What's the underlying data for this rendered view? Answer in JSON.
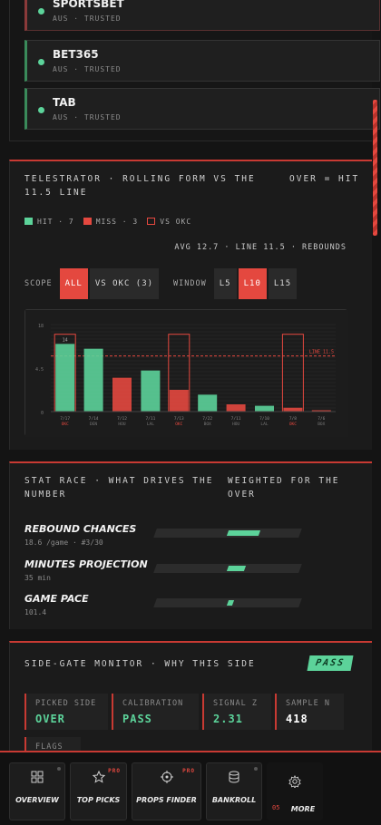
{
  "books": [
    {
      "name": "SPORTSBET",
      "sub": "AUS · TRUSTED"
    },
    {
      "name": "BET365",
      "sub": "AUS · TRUSTED"
    },
    {
      "name": "TAB",
      "sub": "AUS · TRUSTED"
    }
  ],
  "telestrator": {
    "title_left": "TELESTRATOR · ROLLING FORM VS THE 11.5 LINE",
    "title_right": "OVER = HIT",
    "legend": {
      "hit": "HIT · 7",
      "miss": "MISS · 3",
      "vs": "VS OKC"
    },
    "avg": "AVG 12.7 · LINE 11.5 · REBOUNDS",
    "scope_label": "SCOPE",
    "scope_options": [
      "ALL",
      "VS OKC (3)"
    ],
    "window_label": "WINDOW",
    "window_options": [
      "L5",
      "L10",
      "L15"
    ],
    "colors": {
      "hit": "#5cd39a",
      "miss": "#e4483f",
      "accent": "#c83a33"
    }
  },
  "chart_data": {
    "type": "bar",
    "categories": [
      "7/17",
      "7/14",
      "7/12",
      "7/11",
      "7/13",
      "7/22",
      "7/11",
      "7/10",
      "7/8",
      "7/6"
    ],
    "opponents": [
      "OKC",
      "DEN",
      "HOU",
      "LAL",
      "OKC",
      "BOX",
      "HOU",
      "LAL",
      "OKC",
      "BOX"
    ],
    "values": [
      14,
      13,
      7,
      8.5,
      4.5,
      3.5,
      1.5,
      1.2,
      0.8,
      0
    ],
    "hit": [
      true,
      true,
      false,
      true,
      false,
      true,
      false,
      true,
      false,
      false
    ],
    "vs_okc": [
      true,
      false,
      false,
      false,
      true,
      false,
      false,
      false,
      true,
      false
    ],
    "line": 11.5,
    "line_label": "LINE 11.5",
    "top_label": "14",
    "ylim": [
      0,
      18
    ],
    "yticks": [
      0,
      9,
      18
    ],
    "ytick_labels": [
      "0",
      "4.5",
      "18"
    ]
  },
  "stat_race": {
    "title_left": "STAT RACE · WHAT DRIVES THE NUMBER",
    "title_right": "WEIGHTED FOR THE OVER",
    "rows": [
      {
        "name": "REBOUND CHANCES",
        "sub": "18.6 /game · #3/30",
        "start": 0.5,
        "end": 0.72
      },
      {
        "name": "MINUTES PROJECTION",
        "sub": "35 min",
        "start": 0.5,
        "end": 0.62
      },
      {
        "name": "GAME PACE",
        "sub": "101.4",
        "start": 0.5,
        "end": 0.54
      }
    ]
  },
  "side_gate": {
    "title": "SIDE-GATE MONITOR · WHY THIS SIDE",
    "badge": "PASS",
    "cards": [
      {
        "label": "PICKED SIDE",
        "value": "OVER",
        "color": "#5cd39a"
      },
      {
        "label": "CALIBRATION",
        "value": "PASS",
        "color": "#5cd39a"
      },
      {
        "label": "SIGNAL Z",
        "value": "2.31",
        "color": "#5cd39a"
      },
      {
        "label": "SAMPLE N",
        "value": "418",
        "color": "#ffffff"
      }
    ],
    "flags_label": "FLAGS"
  },
  "nav": [
    {
      "label": "OVERVIEW",
      "icon": "grid-icon",
      "pro": ""
    },
    {
      "label": "TOP PICKS",
      "icon": "star-icon",
      "pro": "PRO"
    },
    {
      "label": "PROPS FINDER",
      "icon": "crosshair-icon",
      "pro": "PRO"
    },
    {
      "label": "BANKROLL",
      "icon": "database-icon",
      "pro": ""
    },
    {
      "label": "MORE",
      "icon": "gear-icon",
      "badge": "05"
    }
  ]
}
